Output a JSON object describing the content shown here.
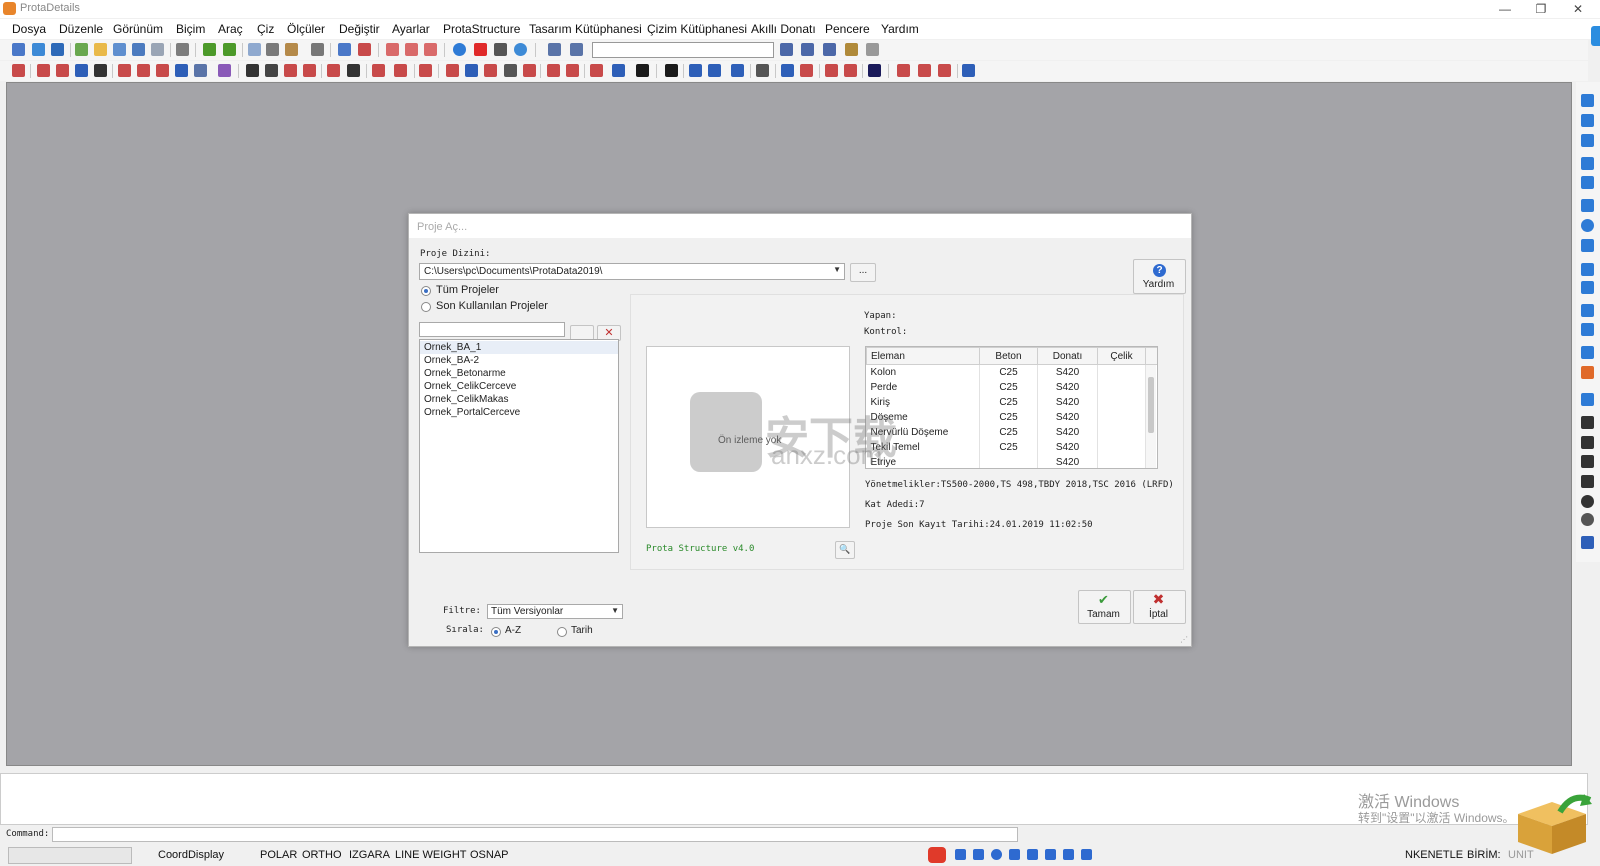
{
  "app": {
    "title": "ProtaDetails"
  },
  "window_controls": {
    "minimize": "—",
    "restore": "❐",
    "close": "✕"
  },
  "menu": [
    "Dosya",
    "Düzenle",
    "Görünüm",
    "Biçim",
    "Araç",
    "Çiz",
    "Ölçüler",
    "Değiştir",
    "Ayarlar",
    "ProtaStructure",
    "Tasarım Kütüphanesi",
    "Çizim Kütüphanesi",
    "Akıllı Donatı",
    "Pencere",
    "Yardım"
  ],
  "dialog": {
    "title": "Proje Aç...",
    "project_dir_label": "Proje Dizini:",
    "project_dir_value": "C:\\Users\\pc\\Documents\\ProtaData2019\\",
    "browse_button": "...",
    "help_button": "Yardım",
    "radio_all": "Tüm Projeler",
    "radio_recent": "Son Kullanılan Projeler",
    "selected_scope": "all",
    "search_value": "",
    "projects": [
      "Ornek_BA_1",
      "Ornek_BA-2",
      "Ornek_Betonarme",
      "Ornek_CelikCerceve",
      "Ornek_CelikMakas",
      "Ornek_PortalCerceve"
    ],
    "selected_project": "Ornek_BA_1",
    "preview_text": "Ön izleme yok",
    "version_text": "Prota Structure v4.0",
    "yapan_label": "Yapan:",
    "kontrol_label": "Kontrol:",
    "table": {
      "headers": [
        "Eleman",
        "Beton",
        "Donatı",
        "Çelik"
      ],
      "rows": [
        [
          "Kolon",
          "C25",
          "S420",
          ""
        ],
        [
          "Perde",
          "C25",
          "S420",
          ""
        ],
        [
          "Kiriş",
          "C25",
          "S420",
          ""
        ],
        [
          "Döşeme",
          "C25",
          "S420",
          ""
        ],
        [
          "Nervürlü Döşeme",
          "C25",
          "S420",
          ""
        ],
        [
          "Tekil Temel",
          "C25",
          "S420",
          ""
        ],
        [
          "Etriye",
          "",
          "S420",
          ""
        ]
      ]
    },
    "regulations": "Yönetmelikler:TS500-2000,TS 498,TBDY 2018,TSC 2016 (LRFD)",
    "floor_count": "Kat Adedi:7",
    "last_save": "Proje Son Kayıt Tarihi:24.01.2019 11:02:50",
    "filter_label": "Filtre:",
    "filter_value": "Tüm Versiyonlar",
    "sort_label": "Sırala:",
    "sort_az": "A-Z",
    "sort_date": "Tarih",
    "selected_sort": "az",
    "ok_button": "Tamam",
    "cancel_button": "İptal"
  },
  "watermark": {
    "text": "安下载",
    "sub": "anxz.com"
  },
  "command": {
    "label": "Command:",
    "value": ""
  },
  "status": {
    "coord": "CoordDisplay",
    "items": [
      "POLAR",
      "ORTHO",
      "IZGARA",
      "LINE WEIGHT",
      "OSNAP"
    ],
    "right_items": [
      "NKENETLE",
      "BİRİM:",
      "UNIT"
    ]
  },
  "windows_activation": {
    "line1": "激活 Windows",
    "line2": "转到\"设置\"以激活 Windows。"
  },
  "colors": {
    "canvas": "#a4a4a8",
    "accent": "#2b8de0",
    "ok": "#3a9a3a",
    "cancel": "#c03030",
    "version_text": "#2a8a2a"
  }
}
